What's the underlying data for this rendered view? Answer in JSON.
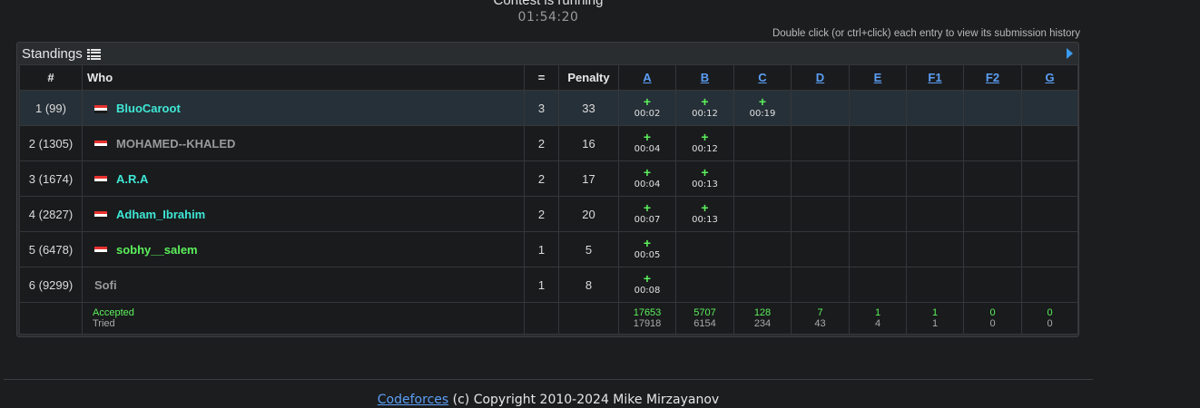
{
  "contest": {
    "status": "Contest is running",
    "timer": "01:54:20"
  },
  "hint": "Double click (or ctrl+click) each entry to view its submission history",
  "standings": {
    "title": "Standings",
    "headers": {
      "rank": "#",
      "who": "Who",
      "solved": "=",
      "penalty": "Penalty"
    },
    "problems": [
      "A",
      "B",
      "C",
      "D",
      "E",
      "F1",
      "F2",
      "G"
    ],
    "rows": [
      {
        "rank": "1 (99)",
        "handle": "BluoCaroot",
        "handle_color": "#3ee8d6",
        "flag": true,
        "solved": "3",
        "penalty": "33",
        "results": [
          {
            "plus": "+",
            "time": "00:02"
          },
          {
            "plus": "+",
            "time": "00:12"
          },
          {
            "plus": "+",
            "time": "00:19"
          },
          null,
          null,
          null,
          null,
          null
        ]
      },
      {
        "rank": "2 (1305)",
        "handle": "MOHAMED--KHALED",
        "handle_color": "#9a9a9a",
        "flag": true,
        "solved": "2",
        "penalty": "16",
        "results": [
          {
            "plus": "+",
            "time": "00:04"
          },
          {
            "plus": "+",
            "time": "00:12"
          },
          null,
          null,
          null,
          null,
          null,
          null
        ]
      },
      {
        "rank": "3 (1674)",
        "handle": "A.R.A",
        "handle_color": "#3ee8d6",
        "flag": true,
        "solved": "2",
        "penalty": "17",
        "results": [
          {
            "plus": "+",
            "time": "00:04"
          },
          {
            "plus": "+",
            "time": "00:13"
          },
          null,
          null,
          null,
          null,
          null,
          null
        ]
      },
      {
        "rank": "4 (2827)",
        "handle": "Adham_Ibrahim",
        "handle_color": "#3ee8d6",
        "flag": true,
        "solved": "2",
        "penalty": "20",
        "results": [
          {
            "plus": "+",
            "time": "00:07"
          },
          {
            "plus": "+",
            "time": "00:13"
          },
          null,
          null,
          null,
          null,
          null,
          null
        ]
      },
      {
        "rank": "5 (6478)",
        "handle": "sobhy__salem",
        "handle_color": "#5bf05b",
        "flag": true,
        "solved": "1",
        "penalty": "5",
        "results": [
          {
            "plus": "+",
            "time": "00:05"
          },
          null,
          null,
          null,
          null,
          null,
          null,
          null
        ]
      },
      {
        "rank": "6 (9299)",
        "handle": "Sofi",
        "handle_color": "#9a9a9a",
        "flag": false,
        "solved": "1",
        "penalty": "8",
        "results": [
          {
            "plus": "+",
            "time": "00:08"
          },
          null,
          null,
          null,
          null,
          null,
          null,
          null
        ]
      }
    ],
    "summary": {
      "accepted_label": "Accepted",
      "tried_label": "Tried",
      "accepted": [
        "17653",
        "5707",
        "128",
        "7",
        "1",
        "1",
        "0",
        "0"
      ],
      "tried": [
        "17918",
        "6154",
        "234",
        "43",
        "4",
        "1",
        "0",
        "0"
      ]
    }
  },
  "footer": {
    "link": "Codeforces",
    "text": " (c) Copyright 2010-2024 Mike Mirzayanov"
  },
  "colors": {
    "accepted_green": "#5bf05b",
    "link_blue": "#5b9ff5",
    "cyan_handle": "#3ee8d6",
    "gray_handle": "#9a9a9a"
  }
}
